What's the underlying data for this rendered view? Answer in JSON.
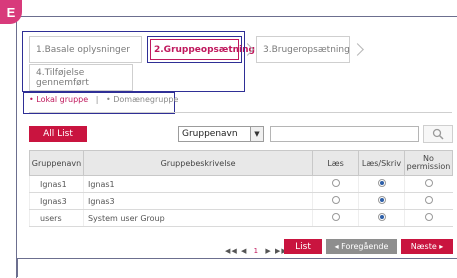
{
  "badge": "E",
  "wizard": {
    "steps": [
      {
        "label": "1.Basale oplysninger"
      },
      {
        "label": "2.Gruppeopsætning"
      },
      {
        "label": "3.Brugeropsætning"
      },
      {
        "label": "4.Tilføjelse gennemført"
      }
    ]
  },
  "tabs": {
    "local": "• Lokal gruppe",
    "divider": "|",
    "domain": "• Domænegruppe"
  },
  "toolbar": {
    "all_list": "All List",
    "filter_value": "Gruppenavn",
    "search_value": ""
  },
  "table": {
    "headers": [
      "Gruppenavn",
      "Gruppebeskrivelse",
      "Læs",
      "Læs/Skriv",
      "No permission"
    ],
    "rows": [
      {
        "name": "Ignas1",
        "desc": "Ignas1",
        "selected": "Læs/Skriv"
      },
      {
        "name": "Ignas3",
        "desc": "Ignas3",
        "selected": "Læs/Skriv"
      },
      {
        "name": "users",
        "desc": "System user Group",
        "selected": "Læs/Skriv"
      }
    ]
  },
  "pager": {
    "first": "◀◀",
    "prev": "◀",
    "page": "1",
    "next": "▶",
    "last": "▶▶"
  },
  "buttons": {
    "list": "List",
    "previous": "◂ Foregående",
    "next": "Næste ▸"
  }
}
